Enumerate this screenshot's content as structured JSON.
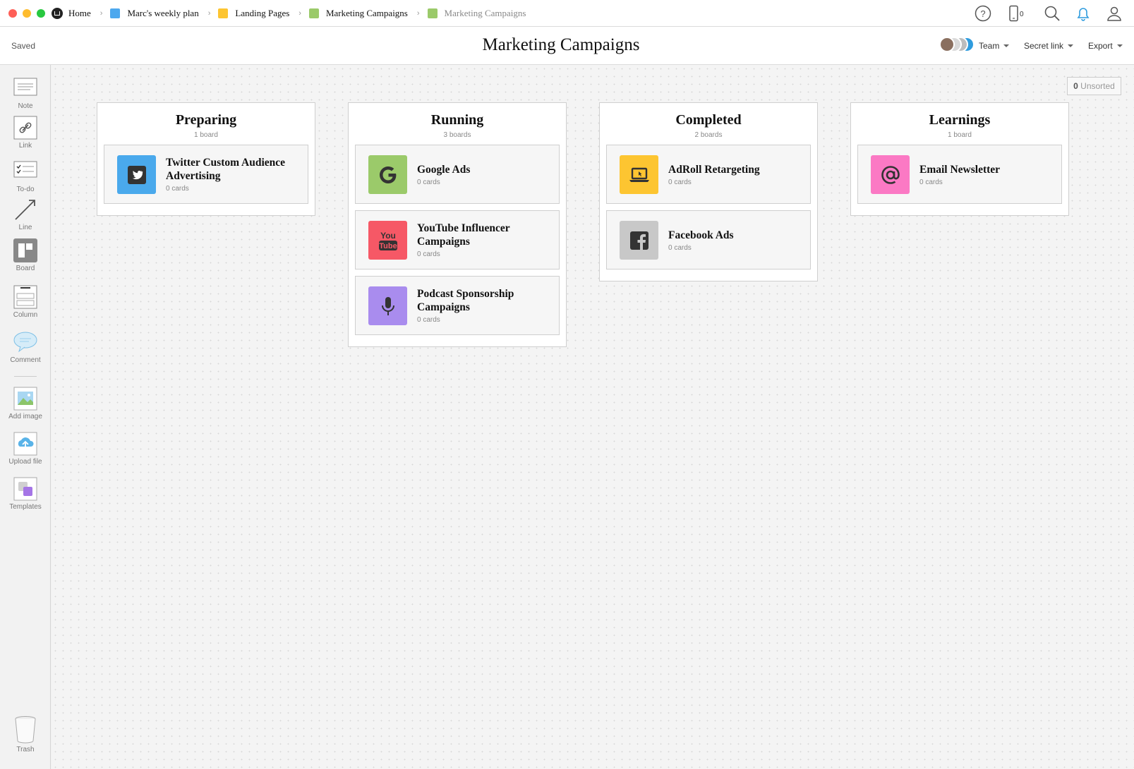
{
  "breadcrumbs": [
    {
      "label": "Home",
      "color": ""
    },
    {
      "label": "Marc's weekly plan",
      "color": "#4da8ee"
    },
    {
      "label": "Landing Pages",
      "color": "#fdc531"
    },
    {
      "label": "Marketing Campaigns",
      "color": "#9bca6a"
    },
    {
      "label": "Marketing Campaigns",
      "color": "#9bca6a"
    }
  ],
  "topbar": {
    "phone_count": "0"
  },
  "header": {
    "status": "Saved",
    "title": "Marketing Campaigns",
    "menus": [
      "Team",
      "Secret link",
      "Export"
    ]
  },
  "toolbar": {
    "items": [
      "Note",
      "Link",
      "To-do",
      "Line",
      "Board",
      "Column",
      "Comment",
      "Add image",
      "Upload file",
      "Templates"
    ],
    "trash": "Trash"
  },
  "canvas": {
    "unsorted_count": "0",
    "unsorted_label": "Unsorted"
  },
  "columns": [
    {
      "title": "Preparing",
      "count": "1 board",
      "boards": [
        {
          "name": "Twitter Custom Audience Advertising",
          "count": "0 cards",
          "color": "#4aa9ec",
          "icon": "twitter-icon"
        }
      ]
    },
    {
      "title": "Running",
      "count": "3 boards",
      "boards": [
        {
          "name": "Google Ads",
          "count": "0 cards",
          "color": "#9bca6a",
          "icon": "google-icon"
        },
        {
          "name": "YouTube Influencer Campaigns",
          "count": "0 cards",
          "color": "#f65866",
          "icon": "youtube-icon"
        },
        {
          "name": "Podcast Sponsorship Campaigns",
          "count": "0 cards",
          "color": "#a98cee",
          "icon": "microphone-icon"
        }
      ]
    },
    {
      "title": "Completed",
      "count": "2 boards",
      "boards": [
        {
          "name": "AdRoll Retargeting",
          "count": "0 cards",
          "color": "#fdc531",
          "icon": "laptop-icon"
        },
        {
          "name": "Facebook Ads",
          "count": "0 cards",
          "color": "#c8c8c8",
          "icon": "facebook-icon"
        }
      ]
    },
    {
      "title": "Learnings",
      "count": "1 board",
      "boards": [
        {
          "name": "Email Newsletter",
          "count": "0 cards",
          "color": "#fb79c4",
          "icon": "at-sign-icon"
        }
      ]
    }
  ]
}
